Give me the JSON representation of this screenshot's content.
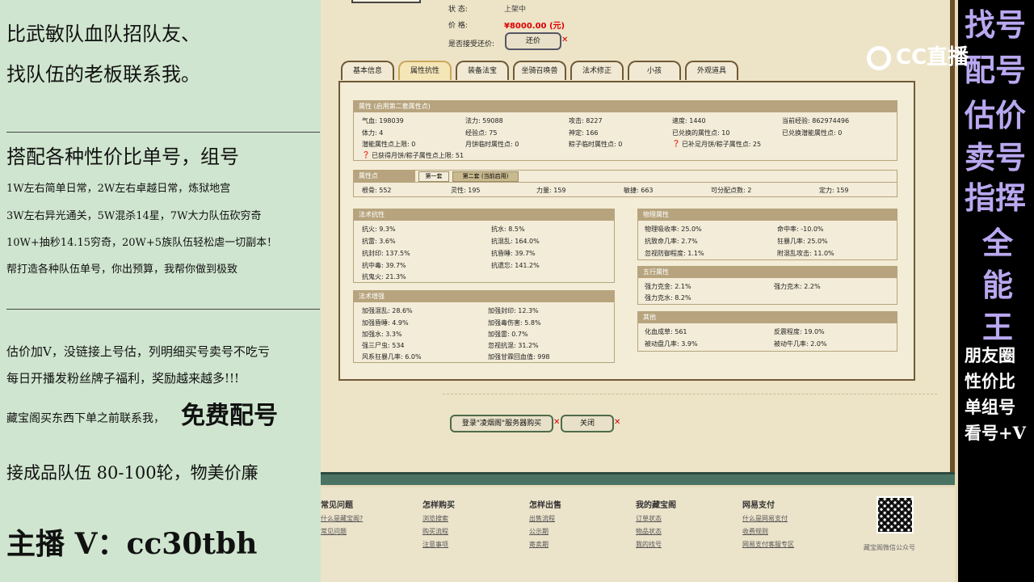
{
  "left_panel": {
    "line1": "比武敏队血队招队友、",
    "line2": "找队伍的老板联系我。",
    "line3": "搭配各种性价比单号，组号",
    "line4": "1W左右简单日常，2W左右卓越日常，炼狱地宫",
    "line5": "3W左右异光通关，5W混杀14星，7W大力队伍砍穷奇",
    "line6": "10W+抽秒14.15穷奇，20W+5族队伍轻松虐一切副本！",
    "line7": "帮打造各种队伍单号，你出预算，我帮你做到极致",
    "line8": "估价加V，没链接上号估，列明细买号卖号不吃亏",
    "line9": "每日开播发粉丝牌子福利，奖励越来越多!!!",
    "line10a": "藏宝阁买东西下单之前联系我，",
    "line10b": "免费配号",
    "line11": "接成品队伍 80-100轮，物美价廉",
    "line12": "主播 V：cc30tbh"
  },
  "right_panel": {
    "c1": "找号",
    "c2": "配号",
    "c3": "估价",
    "c4": "卖号",
    "c5": "指挥",
    "c6": "全",
    "c7": "能",
    "c8": "王",
    "w1": "朋友圈",
    "w2": "性价比",
    "w3": "单组号",
    "w4": "看号+V",
    "cc_logo": "CC直播"
  },
  "game": {
    "status_label": "状 态:",
    "status_value": "上架中",
    "price_label": "价 格:",
    "price_value": "¥8000.00 (元)",
    "bargain_label": "是否接受还价:",
    "bargain_button": "还价",
    "tabs": [
      "基本信息",
      "属性抗性",
      "装备法宝",
      "坐骑召唤兽",
      "法术修正",
      "小孩",
      "外观道具"
    ],
    "attr": {
      "title": "属性 (启用第二套属性点)",
      "r1": [
        "气血: 198039",
        "法力: 59088",
        "攻击: 8227",
        "速度: 1440",
        "当前经验: 862974496"
      ],
      "r2": [
        "体力: 4",
        "经验点: 75",
        "神定: 166",
        "已兑换的属性点: 10",
        "已兑换潜能属性点: 0"
      ],
      "r3": [
        "潜能属性点上限: 0",
        "月饼临时属性点: 0",
        "粽子临时属性点: 0",
        "已补足月饼/粽子属性点: 25"
      ],
      "r4": "已获得月饼/粽子属性点上限: 51"
    },
    "points": {
      "title": "属性点",
      "tab1": "第一套",
      "tab2": "第二套 (当前启用)",
      "r": [
        "根骨: 552",
        "灵性: 195",
        "力量: 159",
        "敏捷: 663",
        "可分配点数: 2",
        "定力: 159"
      ]
    },
    "kang": {
      "title": "法术抗性",
      "rows": [
        [
          "抗火: 9.3%",
          "抗水: 8.5%"
        ],
        [
          "抗雷: 3.6%",
          "抗混乱: 164.0%"
        ],
        [
          "抗封印: 137.5%",
          "抗昏睡: 39.7%"
        ],
        [
          "抗中毒: 39.7%",
          "抗遗忘: 141.2%"
        ],
        [
          "抗鬼火: 21.3%",
          ""
        ]
      ]
    },
    "zq": {
      "title": "法术增强",
      "rows": [
        [
          "加强混乱: 28.6%",
          "加强封印: 12.3%"
        ],
        [
          "加强昏睡: 4.9%",
          "加强毒伤害: 5.8%"
        ],
        [
          "加强水: 3.3%",
          "加强雷: 0.7%"
        ],
        [
          "强三尸虫: 534",
          "忽视抗混: 31.2%"
        ],
        [
          "风系狂暴几率: 6.0%",
          "加强甘霖回血值: 998"
        ]
      ]
    },
    "wl": {
      "title": "物理属性",
      "rows": [
        [
          "物理吸收率: 25.0%",
          "命中率: -10.0%"
        ],
        [
          "抗致命几率: 2.7%",
          "狂暴几率: 25.0%"
        ],
        [
          "忽视防御程度: 1.1%",
          "附混乱攻击: 11.0%"
        ]
      ]
    },
    "wx": {
      "title": "五行属性",
      "rows": [
        [
          "强力克金: 2.1%",
          "强力克木: 2.2%"
        ],
        [
          "强力克水: 8.2%",
          ""
        ]
      ]
    },
    "qt": {
      "title": "其他",
      "rows": [
        [
          "化血成草: 561",
          "反震程度: 19.0%"
        ],
        [
          "被动盘几率: 3.9%",
          "被动牛几率: 2.0%"
        ]
      ]
    },
    "buy_button": "登录\"凌烟阁\"服务器购买",
    "close_button": "关闭",
    "footer": {
      "cols": [
        {
          "h": "常见问题",
          "links": [
            "什么是藏宝阁?",
            "常见问题"
          ]
        },
        {
          "h": "怎样购买",
          "links": [
            "浏览搜索",
            "购买流程",
            "注意事项"
          ]
        },
        {
          "h": "怎样出售",
          "links": [
            "出售流程",
            "公示期",
            "寄卖期"
          ]
        },
        {
          "h": "我的藏宝阁",
          "links": [
            "订单状态",
            "物品状态",
            "我的找号"
          ]
        },
        {
          "h": "网易支付",
          "links": [
            "什么是网易支付",
            "收费规则",
            "网易支付客服专区"
          ]
        }
      ],
      "qr_caption": "藏宝阁微信公众号"
    }
  }
}
